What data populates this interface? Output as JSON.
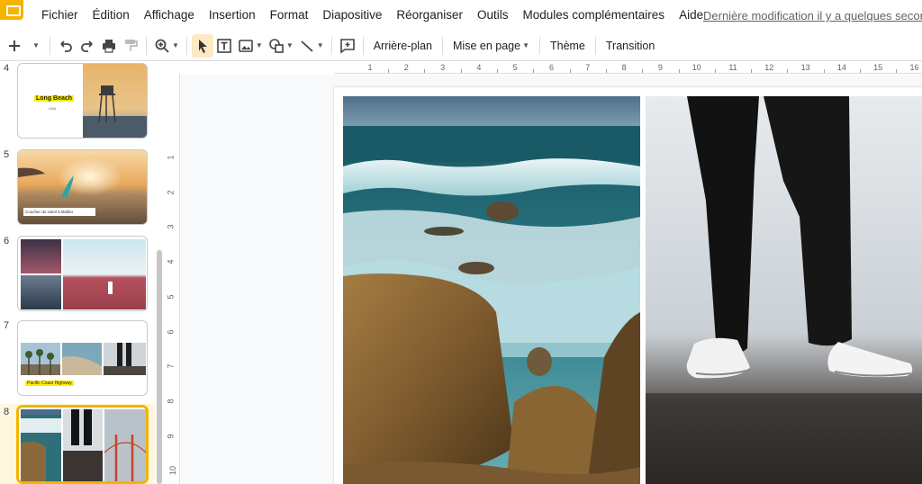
{
  "menu": {
    "items": [
      "Fichier",
      "Édition",
      "Affichage",
      "Insertion",
      "Format",
      "Diapositive",
      "Réorganiser",
      "Outils",
      "Modules complémentaires",
      "Aide"
    ],
    "last_edit": "Dernière modification il y a quelques secondes"
  },
  "toolbar": {
    "background_label": "Arrière-plan",
    "layout_label": "Mise en page",
    "theme_label": "Thème",
    "transition_label": "Transition"
  },
  "filmstrip": {
    "slides": [
      {
        "number": "4",
        "caption": "Long Beach",
        "subcaption": "USA"
      },
      {
        "number": "5",
        "caption": "Coucher du soleil à Malibu"
      },
      {
        "number": "6"
      },
      {
        "number": "7",
        "caption": "Pacific Coast Highway"
      },
      {
        "number": "8",
        "selected": true
      }
    ]
  },
  "ruler": {
    "h_ticks": [
      "1",
      "2",
      "3",
      "4",
      "5",
      "6",
      "7",
      "8",
      "9",
      "10",
      "11",
      "12",
      "13",
      "14",
      "15",
      "16"
    ],
    "v_ticks": [
      "1",
      "2",
      "3",
      "4",
      "5",
      "6",
      "7",
      "8",
      "9",
      "10"
    ]
  },
  "colors": {
    "accent": "#f4b400",
    "selection_bg": "#fef7e0",
    "highlight": "#fff000"
  }
}
